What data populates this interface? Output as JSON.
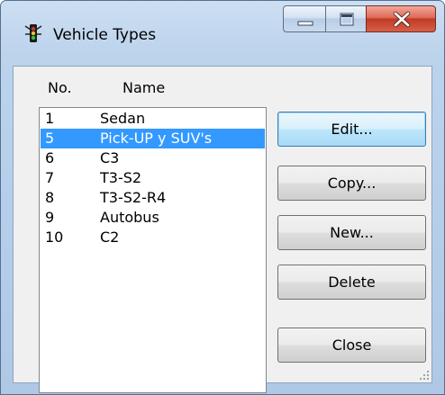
{
  "window": {
    "title": "Vehicle Types",
    "icon": "traffic-light-icon",
    "caption_buttons": [
      "minimize-icon",
      "maximize-icon",
      "close-icon"
    ]
  },
  "columns": {
    "no": "No.",
    "name": "Name"
  },
  "vehicle_types": [
    {
      "no": "1",
      "name": "Sedan",
      "selected": false
    },
    {
      "no": "5",
      "name": "Pick-UP y SUV's",
      "selected": true
    },
    {
      "no": "6",
      "name": "C3",
      "selected": false
    },
    {
      "no": "7",
      "name": "T3-S2",
      "selected": false
    },
    {
      "no": "8",
      "name": "T3-S2-R4",
      "selected": false
    },
    {
      "no": "9",
      "name": "Autobus",
      "selected": false
    },
    {
      "no": "10",
      "name": "C2",
      "selected": false
    }
  ],
  "buttons": {
    "edit": "Edit...",
    "copy": "Copy...",
    "new": "New...",
    "delete": "Delete",
    "close": "Close"
  },
  "colors": {
    "selection": "#3399ff",
    "title_bar": "#bcd3ec",
    "close_button": "#c23a22"
  }
}
